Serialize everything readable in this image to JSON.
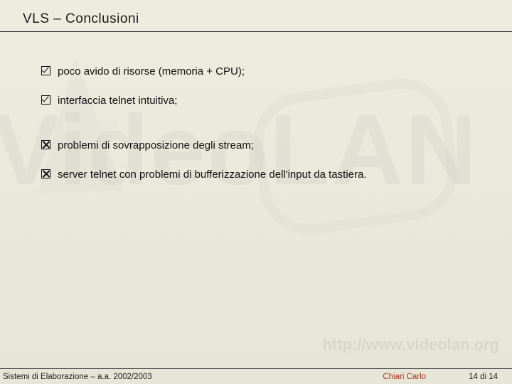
{
  "title": "VLS –  Conclusioni",
  "bullets_positive": [
    "poco avido di risorse (memoria + CPU);",
    "interfaccia telnet intuitiva;"
  ],
  "bullets_negative": [
    "problemi di sovrapposizione degli stream;",
    "server telnet con problemi di bufferizzazione dell'input da tastiera."
  ],
  "watermark": {
    "main": "VideoLAN",
    "url": "http://www.videolan.org"
  },
  "footer": {
    "left": "Sistemi di Elaborazione – a.a. 2002/2003",
    "center": "Chiari Carlo",
    "right": "14 di 14"
  }
}
